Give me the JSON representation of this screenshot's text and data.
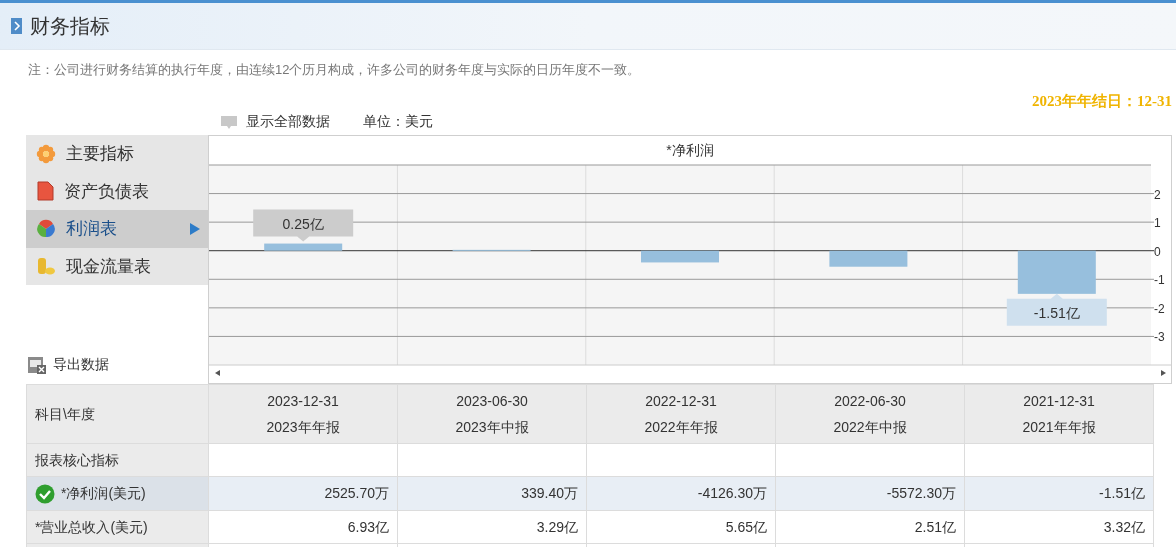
{
  "header": {
    "title": "财务指标"
  },
  "note": "注：公司进行财务结算的执行年度，由连续12个历月构成，许多公司的财务年度与实际的日历年度不一致。",
  "toolbar": {
    "show_all": "显示全部数据",
    "unit": "单位：美元",
    "year_end": "2023年年结日：12-31"
  },
  "sidebar": {
    "items": [
      {
        "label": "主要指标",
        "selected": false
      },
      {
        "label": "资产负债表",
        "selected": false
      },
      {
        "label": "利润表",
        "selected": true
      },
      {
        "label": "现金流量表",
        "selected": false
      }
    ]
  },
  "export": "导出数据",
  "chart": {
    "chart_data": {
      "type": "bar",
      "title": "*净利润",
      "values": [
        0.25,
        0.03,
        -0.41,
        -0.56,
        -1.51
      ],
      "ylim": [
        -4,
        3
      ],
      "yticks": [
        2,
        1,
        0,
        -1,
        -2,
        -3
      ],
      "grid": true,
      "value_labels": [
        "0.25亿",
        null,
        null,
        null,
        "-1.51亿"
      ]
    }
  },
  "table": {
    "corner": "科目\\年度",
    "columns": [
      {
        "date": "2023-12-31",
        "report": "2023年年报"
      },
      {
        "date": "2023-06-30",
        "report": "2023年中报"
      },
      {
        "date": "2022-12-31",
        "report": "2022年年报"
      },
      {
        "date": "2022-06-30",
        "report": "2022年中报"
      },
      {
        "date": "2021-12-31",
        "report": "2021年年报"
      }
    ],
    "rows": [
      {
        "kind": "section",
        "label": "报表核心指标",
        "selected": false
      },
      {
        "kind": "data",
        "label": "*净利润(美元)",
        "selected": true,
        "cells": [
          "2525.70万",
          "339.40万",
          "-4126.30万",
          "-5572.30万",
          "-1.51亿"
        ]
      },
      {
        "kind": "data",
        "label": "*营业总收入(美元)",
        "selected": false,
        "cells": [
          "6.93亿",
          "3.29亿",
          "5.65亿",
          "2.51亿",
          "3.32亿"
        ]
      }
    ]
  }
}
